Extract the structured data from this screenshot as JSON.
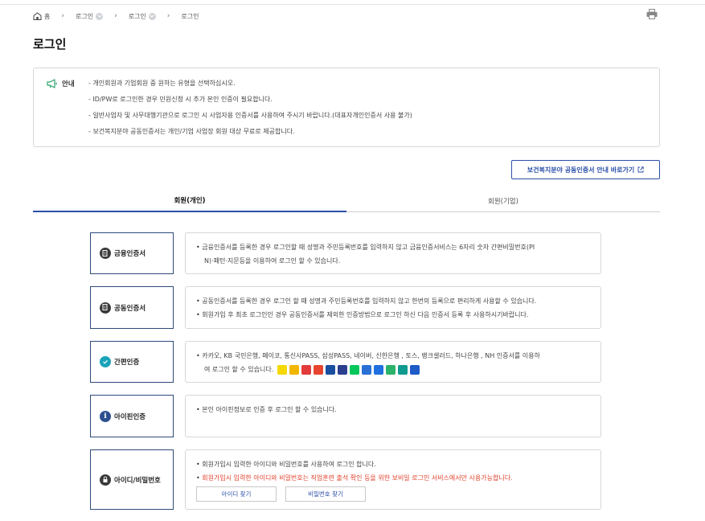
{
  "breadcrumb": {
    "home": "홈",
    "items": [
      "로그인",
      "로그인",
      "로그인"
    ]
  },
  "page_title": "로그인",
  "notice": {
    "label": "안내",
    "items": [
      "개인회원과 기업회원 중 원하는 유형을 선택하십시오.",
      "ID/PW로 로그인한 경우 민원신청 시 추가 본인 인증이 필요합니다.",
      "일반사업자 및 사무대행기관으로 로그인 시 사업자용 인증서를 사용하여 주시기 바랍니다.(대표자개인인증서 사용 불가)",
      "보건복지분야 공동인증서는 개인/기업 사업장 회원 대상 무료로 제공합니다."
    ]
  },
  "link_button": {
    "label": "보건복지분야 공동인증서 안내 바로가기",
    "icon": "external-link-icon"
  },
  "tabs": [
    {
      "label": "회원(개인)",
      "active": true
    },
    {
      "label": "회원(기업)",
      "active": false
    }
  ],
  "auth_methods": {
    "financial": {
      "label": "금융인증서",
      "icon": "certificate-icon",
      "desc": [
        "금융인증서를 등록한 경우 로그인할 때 성명과 주민등록번호를 입력하지 않고 금융인증서비스는 6자리 숫자 간편비밀번호(PI",
        "N)·패턴·지문등을 이용하여 로그인 할 수 있습니다."
      ]
    },
    "joint": {
      "label": "공동인증서",
      "icon": "certificate-icon",
      "desc": [
        "공동인증서를 등록한 경우 로그인 할 때 성명과 주민등록번호를 입력하지 않고 한번의 등록으로 편리하게 사용할 수 있습니다.",
        "회원가입 후 최초 로그인인 경우 공동인증서를 제외한 인증방법으로 로그인 하신 다음 인증서 등록 후 사용하시기바랍니다."
      ]
    },
    "simple": {
      "label": "간편인증",
      "icon": "shield-check-icon",
      "desc": [
        "카카오, KB 국민은행, 페이코, 통신사PASS, 삼성PASS, 네이버, 신한은행 , 토스, 뱅크샐러드, 하나은행 , NH 인증서를 이용하",
        "여 로그인 할 수 있습니다."
      ],
      "logos": [
        "#f5d800",
        "#f2b600",
        "#e23b3b",
        "#e8452e",
        "#1a4fa0",
        "#2c3f8f",
        "#03c75a",
        "#2a6fd6",
        "#1f6fe0",
        "#2cb36b",
        "#0f9a8f",
        "#1e5bc6"
      ]
    },
    "ipin": {
      "label": "아이핀인증",
      "icon": "info-icon",
      "desc": [
        "본인 아이핀정보로 인증 후 로그인 할 수 있습니다."
      ]
    },
    "idpw": {
      "label": "아이디/비밀번호",
      "icon": "lock-icon",
      "desc": [
        "회원가입시 입력한 아이디와 비밀번호를 사용하여 로그인 합니다.",
        "회원가입시 입력한 아이디와 비밀번호는 직업훈련 출석 확인 등을 위한 보비일 로그인 서비스에서만 사용가능합니다."
      ],
      "find_id": "아이디 찾기",
      "find_pw": "비밀번호 찾기"
    }
  },
  "colors": {
    "accent": "#2b4fa8",
    "border_dark": "#2f4a7a",
    "warning": "#e0412b"
  }
}
